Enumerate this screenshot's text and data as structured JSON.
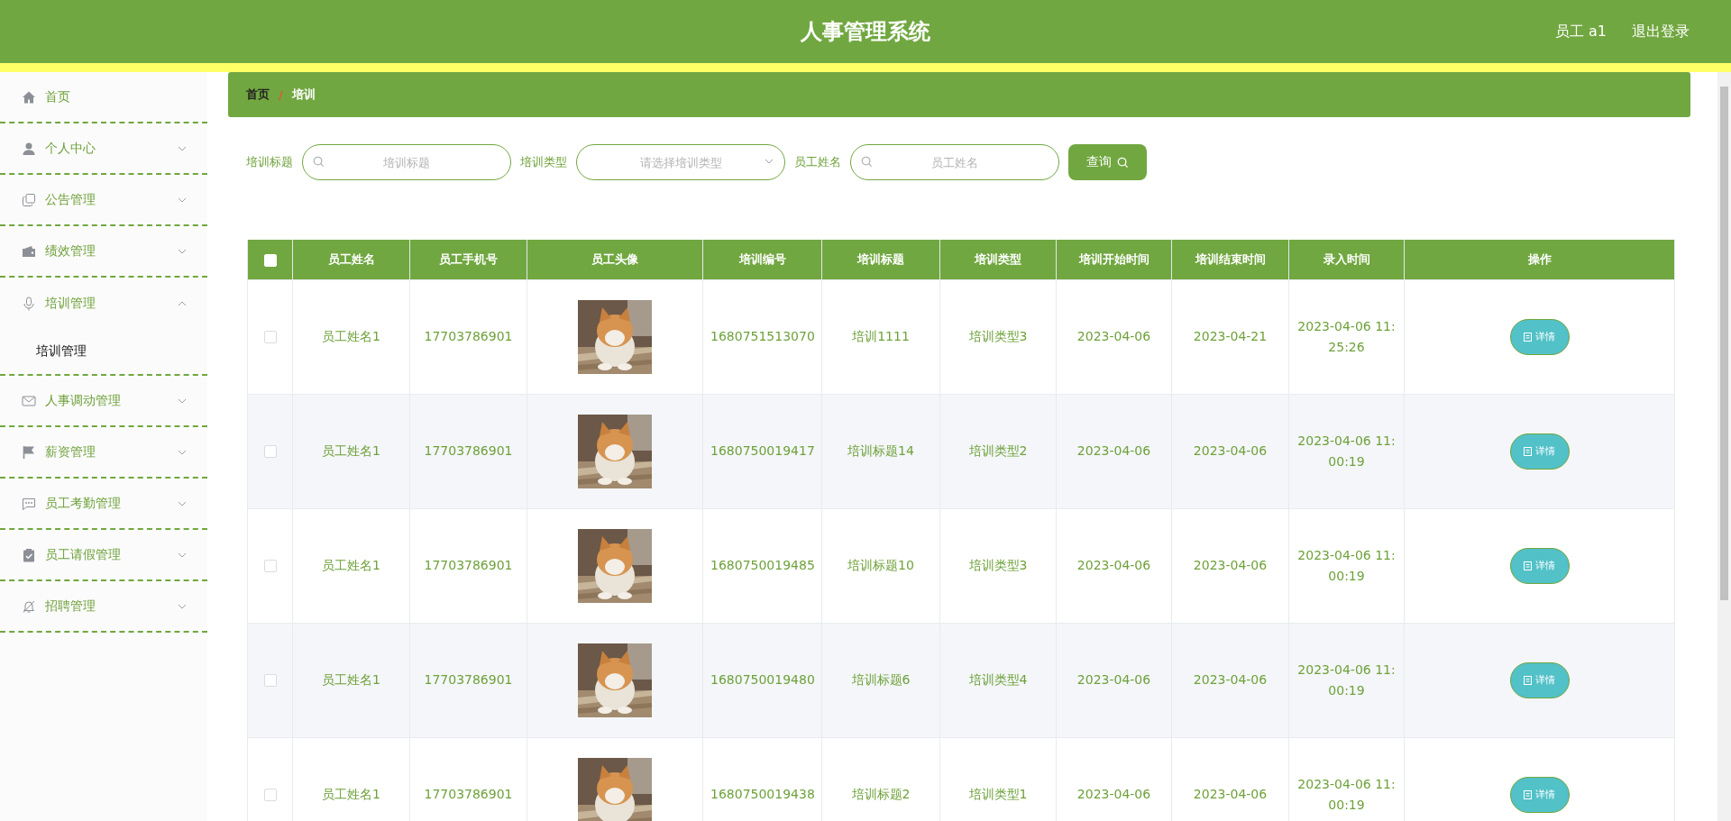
{
  "header": {
    "title": "人事管理系统",
    "user": "员工 a1",
    "logout": "退出登录"
  },
  "sidebar": {
    "items": [
      {
        "kind": "link",
        "label": "首页"
      },
      {
        "kind": "menu",
        "label": "个人中心",
        "expanded": false
      },
      {
        "kind": "menu",
        "label": "公告管理",
        "expanded": false
      },
      {
        "kind": "menu",
        "label": "绩效管理",
        "expanded": false
      },
      {
        "kind": "menu",
        "label": "培训管理",
        "expanded": true,
        "children": [
          {
            "label": "培训管理"
          }
        ]
      },
      {
        "kind": "menu",
        "label": "人事调动管理",
        "expanded": false
      },
      {
        "kind": "menu",
        "label": "薪资管理",
        "expanded": false
      },
      {
        "kind": "menu",
        "label": "员工考勤管理",
        "expanded": false
      },
      {
        "kind": "menu",
        "label": "员工请假管理",
        "expanded": false
      },
      {
        "kind": "menu",
        "label": "招聘管理",
        "expanded": false
      }
    ]
  },
  "breadcrumb": [
    "首页",
    "培训"
  ],
  "breadcrumb_separator": "/",
  "search": {
    "fields": [
      {
        "kind": "input",
        "label": "培训标题",
        "placeholder": "培训标题"
      },
      {
        "kind": "select",
        "label": "培训类型",
        "placeholder": "请选择培训类型"
      },
      {
        "kind": "input",
        "label": "员工姓名",
        "placeholder": "员工姓名"
      }
    ],
    "button": "查询"
  },
  "table": {
    "all_checked": false,
    "columns": [
      "员工姓名",
      "员工手机号",
      "员工头像",
      "培训编号",
      "培训标题",
      "培训类型",
      "培训开始时间",
      "培训结束时间",
      "录入时间",
      "操作"
    ],
    "rows": [
      {
        "checked": false,
        "name": "员工姓名1",
        "phone": "17703786901",
        "code": "1680751513070",
        "title": "培训1111",
        "type": "培训类型3",
        "start": "2023-04-06",
        "end": "2023-04-21",
        "entered": "2023-04-06 11:25:26",
        "action": "详情"
      },
      {
        "checked": false,
        "name": "员工姓名1",
        "phone": "17703786901",
        "code": "1680750019417",
        "title": "培训标题14",
        "type": "培训类型2",
        "start": "2023-04-06",
        "end": "2023-04-06",
        "entered": "2023-04-06 11:00:19",
        "action": "详情"
      },
      {
        "checked": false,
        "name": "员工姓名1",
        "phone": "17703786901",
        "code": "1680750019485",
        "title": "培训标题10",
        "type": "培训类型3",
        "start": "2023-04-06",
        "end": "2023-04-06",
        "entered": "2023-04-06 11:00:19",
        "action": "详情"
      },
      {
        "checked": false,
        "name": "员工姓名1",
        "phone": "17703786901",
        "code": "1680750019480",
        "title": "培训标题6",
        "type": "培训类型4",
        "start": "2023-04-06",
        "end": "2023-04-06",
        "entered": "2023-04-06 11:00:19",
        "action": "详情"
      },
      {
        "checked": false,
        "name": "员工姓名1",
        "phone": "17703786901",
        "code": "1680750019438",
        "title": "培训标题2",
        "type": "培训类型1",
        "start": "2023-04-06",
        "end": "2023-04-06",
        "entered": "2023-04-06 11:00:19",
        "action": "详情"
      }
    ]
  }
}
